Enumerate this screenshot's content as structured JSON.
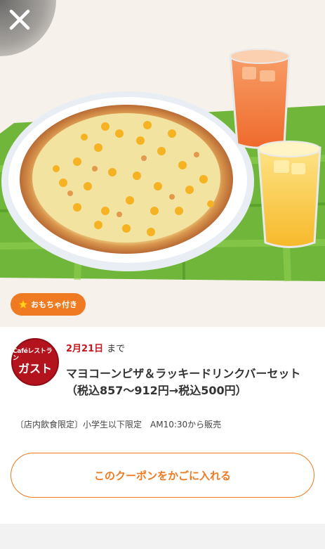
{
  "hero": {
    "close_icon": "close-icon",
    "badge": {
      "icon": "star-icon",
      "label": "おもちゃ付き"
    }
  },
  "coupon": {
    "logo": {
      "line1": "Caféレストラン",
      "line2": "ガスト"
    },
    "deadline": {
      "date": "2月21日",
      "suffix": "まで"
    },
    "title_line1": "マヨコーンピザ＆ラッキードリンクバーセット",
    "title_line2": "（税込857〜912円→税込500円）",
    "conditions": "〔店内飲食限定〕小学生以下限定　AM10:30から販売",
    "button_label": "このクーポンをかごに入れる"
  },
  "colors": {
    "accent": "#f07a22",
    "brand_red": "#c8161d",
    "placemat_green": "#6fb63a"
  }
}
